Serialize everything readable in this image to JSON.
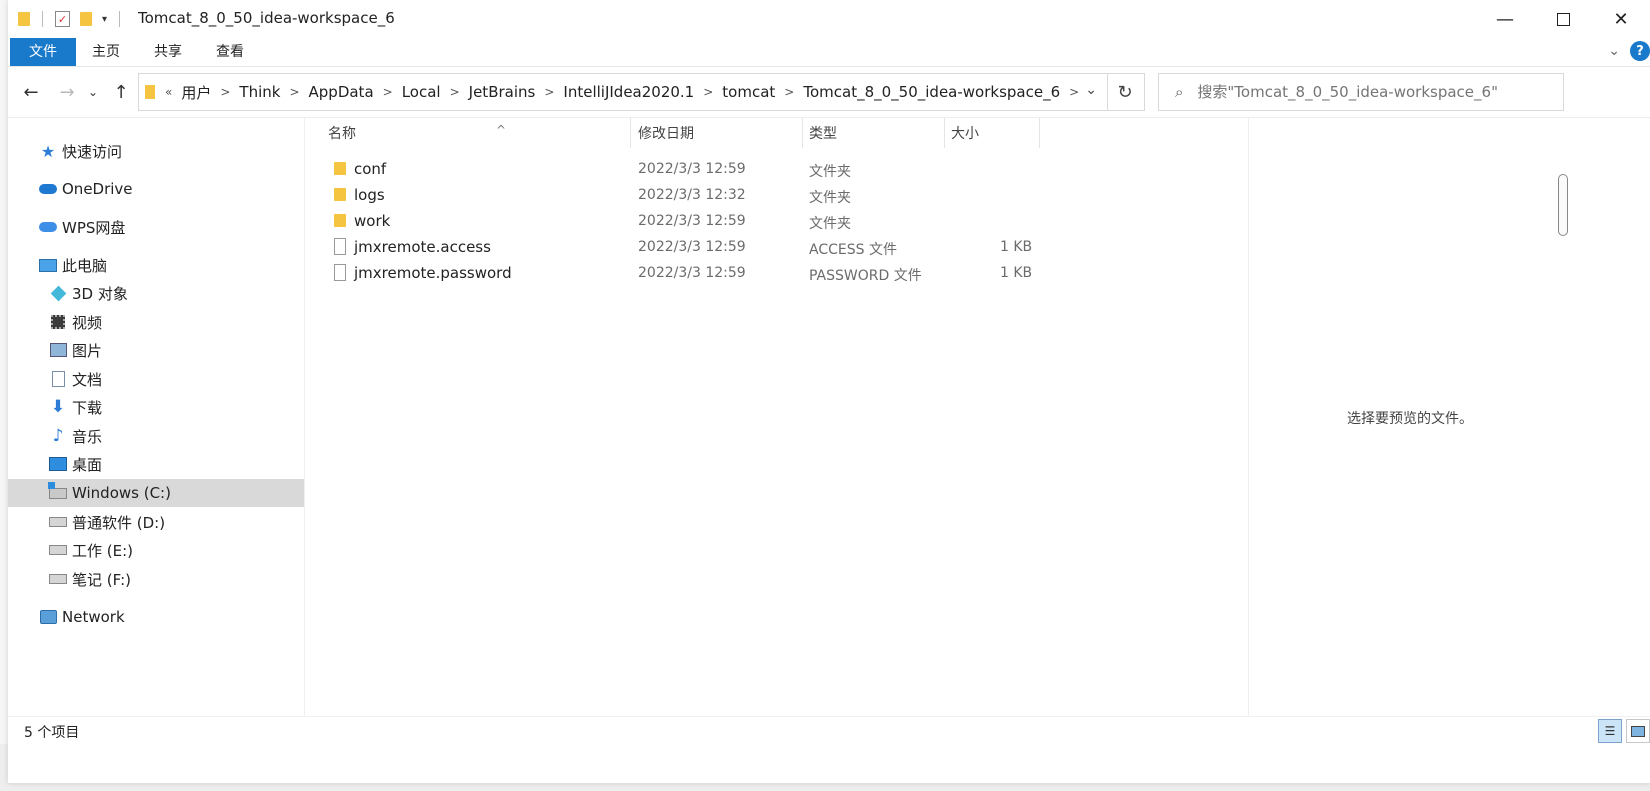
{
  "window": {
    "title": "Tomcat_8_0_50_idea-workspace_6"
  },
  "ribbon": {
    "tabs": [
      "文件",
      "主页",
      "共享",
      "查看"
    ]
  },
  "address": {
    "crumbs": [
      "用户",
      "Think",
      "AppData",
      "Local",
      "JetBrains",
      "IntelliJIdea2020.1",
      "tomcat",
      "Tomcat_8_0_50_idea-workspace_6"
    ]
  },
  "search": {
    "placeholder": "搜索\"Tomcat_8_0_50_idea-workspace_6\""
  },
  "nav": {
    "quick_access": "快速访问",
    "onedrive": "OneDrive",
    "wps": "WPS网盘",
    "this_pc": "此电脑",
    "objects3d": "3D 对象",
    "videos": "视频",
    "pictures": "图片",
    "documents": "文档",
    "downloads": "下载",
    "music": "音乐",
    "desktop": "桌面",
    "drive_c": "Windows (C:)",
    "drive_d": "普通软件 (D:)",
    "drive_e": "工作 (E:)",
    "drive_f": "笔记 (F:)",
    "network": "Network"
  },
  "columns": {
    "name": "名称",
    "date": "修改日期",
    "type": "类型",
    "size": "大小"
  },
  "files": [
    {
      "name": "conf",
      "date": "2022/3/3 12:59",
      "type": "文件夹",
      "size": "",
      "kind": "folder"
    },
    {
      "name": "logs",
      "date": "2022/3/3 12:32",
      "type": "文件夹",
      "size": "",
      "kind": "folder"
    },
    {
      "name": "work",
      "date": "2022/3/3 12:59",
      "type": "文件夹",
      "size": "",
      "kind": "folder"
    },
    {
      "name": "jmxremote.access",
      "date": "2022/3/3 12:59",
      "type": "ACCESS 文件",
      "size": "1 KB",
      "kind": "file"
    },
    {
      "name": "jmxremote.password",
      "date": "2022/3/3 12:59",
      "type": "PASSWORD 文件",
      "size": "1 KB",
      "kind": "file"
    }
  ],
  "preview": {
    "empty_text": "选择要预览的文件。"
  },
  "status": {
    "item_count": "5 个项目"
  },
  "colors": {
    "accent": "#1979ca",
    "folder": "#f5c542",
    "selected": "#d9d9d9"
  }
}
